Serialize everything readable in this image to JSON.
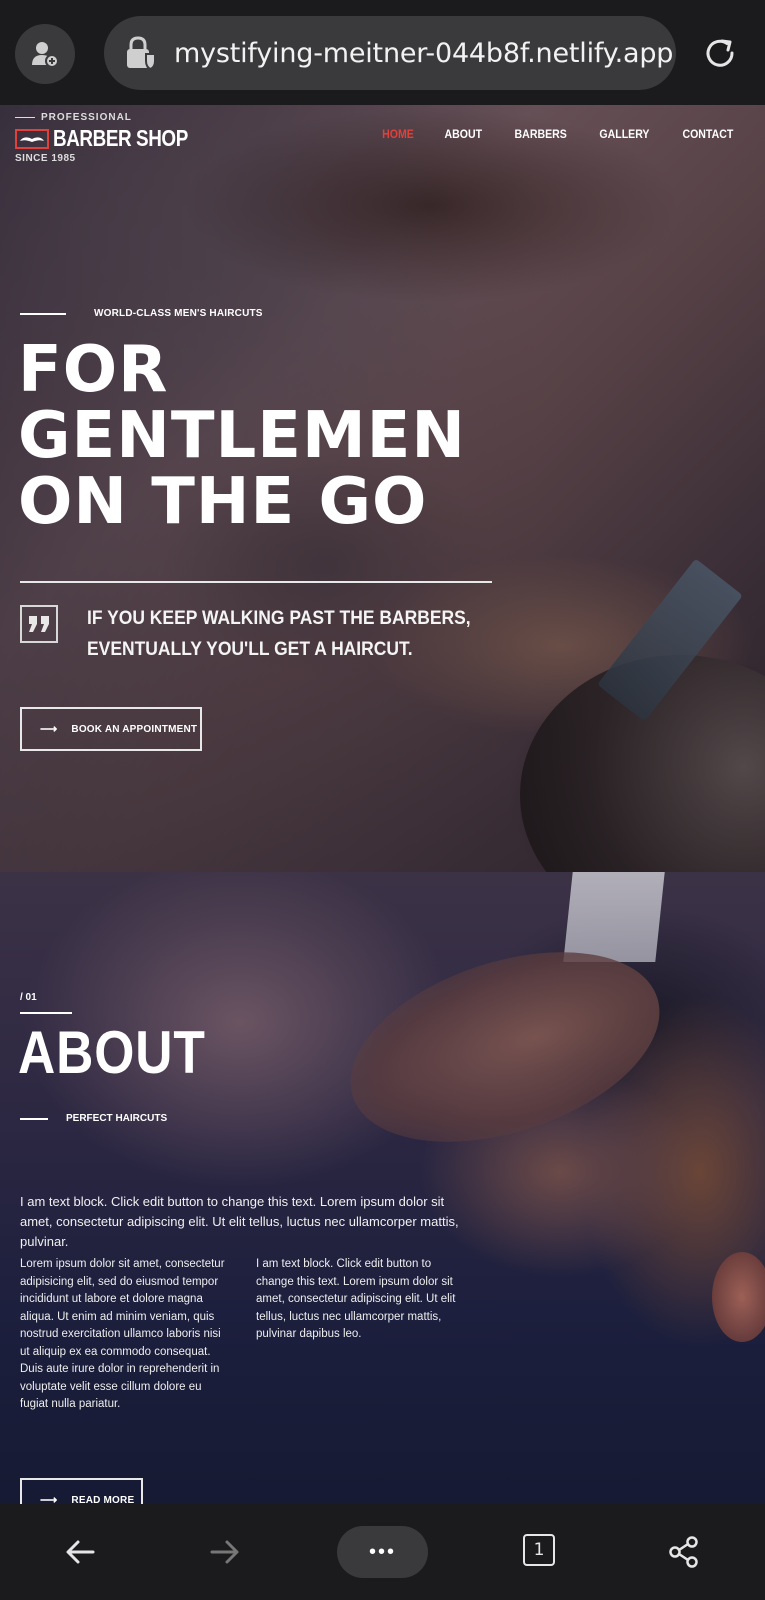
{
  "browser": {
    "url": "mystifying-meitner-044b8f.netlify.app",
    "tab_count": "1",
    "more_label": "•••"
  },
  "site": {
    "logo": {
      "top": "PROFESSIONAL",
      "name": "BARBER SHOP",
      "since": "SINCE 1985"
    },
    "nav": [
      "HOME",
      "ABOUT",
      "BARBERS",
      "GALLERY",
      "CONTACT"
    ],
    "nav_active": "HOME",
    "accent_color": "#e2403a"
  },
  "hero": {
    "eyebrow": "WORLD-CLASS MEN'S HAIRCUTS",
    "headline": [
      "FOR",
      "GENTLEMEN",
      "ON THE GO"
    ],
    "quote_lines": [
      "IF YOU KEEP WALKING PAST THE BARBERS,",
      "EVENTUALLY YOU'LL GET A HAIRCUT."
    ],
    "cta": "BOOK AN APPOINTMENT"
  },
  "about": {
    "number": "/ 01",
    "title": "ABOUT",
    "subtitle": "PERFECT HAIRCUTS",
    "lead": "I am text block. Click edit button to change this text. Lorem ipsum dolor sit amet, consectetur adipiscing elit. Ut elit tellus, luctus nec ullamcorper mattis, pulvinar.",
    "col1": "Lorem ipsum dolor sit amet, consectetur adipisicing elit, sed do eiusmod tempor incididunt ut labore et dolore magna aliqua. Ut enim ad minim veniam, quis nostrud exercitation ullamco laboris nisi ut aliquip ex ea commodo consequat. Duis aute irure dolor in reprehenderit in voluptate velit esse cillum dolore eu fugiat nulla pariatur.",
    "col2": "I am text block. Click edit button to change this text. Lorem ipsum dolor sit amet, consectetur adipiscing elit. Ut elit tellus, luctus nec ullamcorper mattis, pulvinar dapibus leo.",
    "cta": "READ MORE"
  },
  "icons": {
    "profile": "profile-add-icon",
    "lock": "site-lock-icon",
    "reload": "reload-icon",
    "back": "back-arrow-icon",
    "forward": "forward-arrow-icon",
    "share": "share-icon",
    "quote": "quote-icon",
    "arrow": "right-arrow-icon"
  }
}
